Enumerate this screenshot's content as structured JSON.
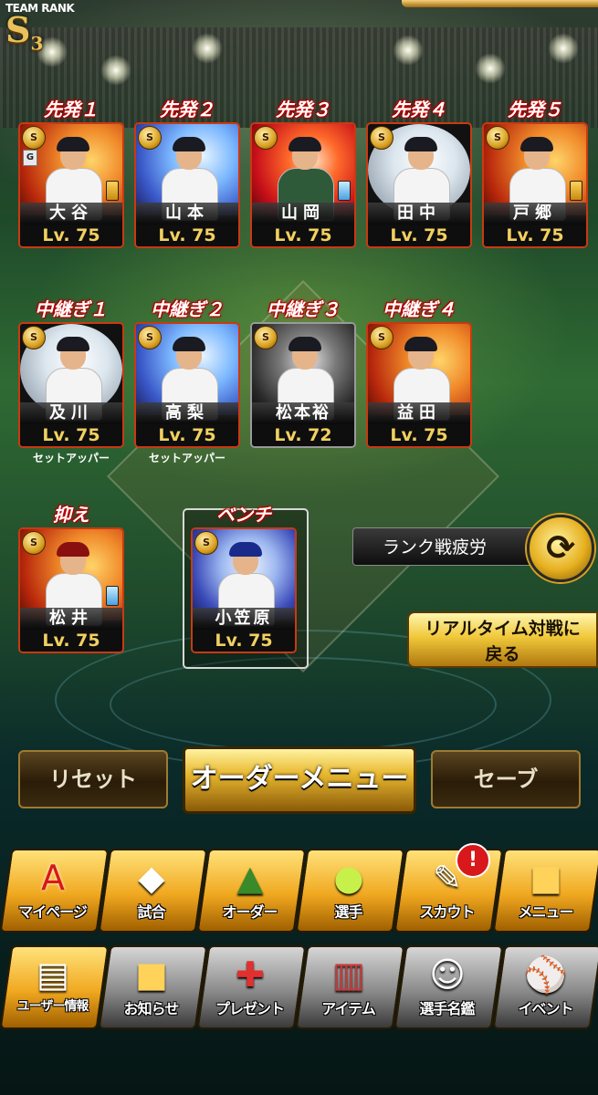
{
  "team_rank": {
    "label": "TEAM RANK",
    "rank": "S",
    "level": "3"
  },
  "starters": [
    {
      "slot": "先発１",
      "name": "大谷",
      "level": "Lv. 75",
      "badge": "S",
      "chip": "gold",
      "tag": "G"
    },
    {
      "slot": "先発２",
      "name": "山本",
      "level": "Lv. 75",
      "badge": "S"
    },
    {
      "slot": "先発３",
      "name": "山岡",
      "level": "Lv. 75",
      "badge": "S",
      "chip": "blue"
    },
    {
      "slot": "先発４",
      "name": "田中",
      "level": "Lv. 75",
      "badge": "S"
    },
    {
      "slot": "先発５",
      "name": "戸郷",
      "level": "Lv. 75",
      "badge": "S",
      "chip": "gold"
    }
  ],
  "relievers": [
    {
      "slot": "中継ぎ１",
      "name": "及川",
      "level": "Lv. 75",
      "badge": "S",
      "role": "セットアッパー"
    },
    {
      "slot": "中継ぎ２",
      "name": "高梨",
      "level": "Lv. 75",
      "badge": "S",
      "role": "セットアッパー"
    },
    {
      "slot": "中継ぎ３",
      "name": "松本裕",
      "level": "Lv. 72",
      "badge": "S"
    },
    {
      "slot": "中継ぎ４",
      "name": "益田",
      "level": "Lv. 75",
      "badge": "S"
    }
  ],
  "closer": {
    "slot": "抑え",
    "name": "松井",
    "level": "Lv. 75",
    "badge": "S",
    "chip": "blue"
  },
  "bench": {
    "slot": "ベンチ",
    "name": "小笠原",
    "level": "Lv. 75",
    "badge": "S"
  },
  "side": {
    "fatigue_label": "ランク戦疲労",
    "realtime_label_line1": "リアルタイム対戦に",
    "realtime_label_line2": "戻る"
  },
  "actions": {
    "reset": "リセット",
    "order_menu": "オーダーメニュー",
    "save": "セーブ"
  },
  "menu_row1": [
    {
      "label": "マイページ",
      "icon": "A"
    },
    {
      "label": "試合",
      "icon": "◆"
    },
    {
      "label": "オーダー",
      "icon": "▲"
    },
    {
      "label": "選手",
      "icon": "●"
    },
    {
      "label": "スカウト",
      "icon": "✎"
    },
    {
      "label": "メニュー",
      "icon": "■"
    }
  ],
  "menu_row2": [
    {
      "label": "ユーザー情報",
      "icon": "▤"
    },
    {
      "label": "お知らせ",
      "icon": "■"
    },
    {
      "label": "プレゼント",
      "icon": "✚"
    },
    {
      "label": "アイテム",
      "icon": "▥"
    },
    {
      "label": "選手名鑑",
      "icon": "☺"
    },
    {
      "label": "イベント",
      "icon": "⚾"
    }
  ],
  "notification_badge": "!",
  "colors": {
    "accent_gold": "#f0c83a",
    "slot_label_glow": "#cc0000",
    "level_text": "#f2d060"
  }
}
